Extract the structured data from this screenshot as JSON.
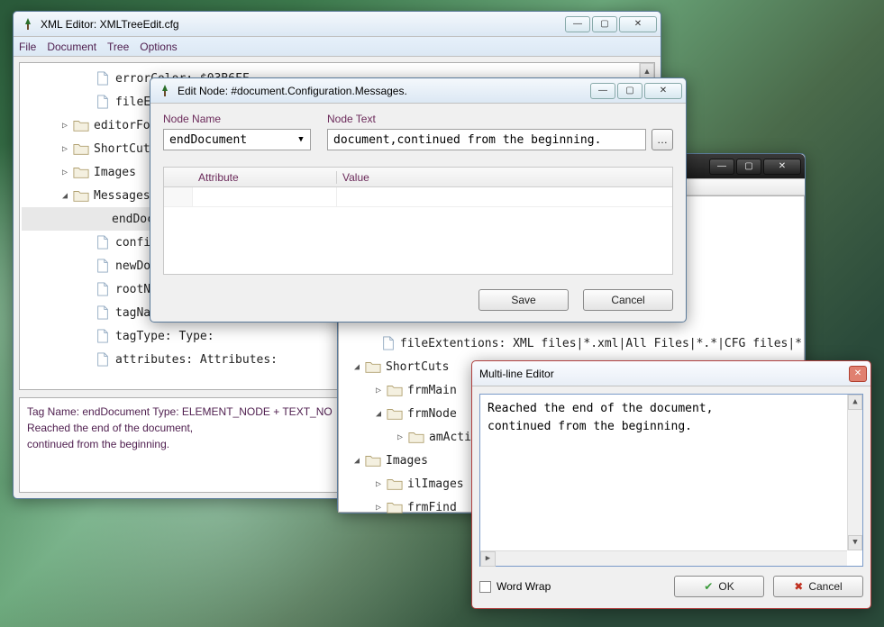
{
  "main": {
    "title": "XML Editor: XMLTreeEdit.cfg",
    "menu": [
      "File",
      "Document",
      "Tree",
      "Options"
    ],
    "tree": [
      {
        "depth": 2,
        "icon": "file",
        "exp": "",
        "text": "errorColor: $03B6FF"
      },
      {
        "depth": 2,
        "icon": "file",
        "exp": "",
        "text": "fileExte"
      },
      {
        "depth": 1,
        "icon": "folder",
        "exp": "▷",
        "text": "editorFont"
      },
      {
        "depth": 1,
        "icon": "folder",
        "exp": "▷",
        "text": "ShortCuts"
      },
      {
        "depth": 1,
        "icon": "folder",
        "exp": "▷",
        "text": "Images"
      },
      {
        "depth": 1,
        "icon": "folder",
        "exp": "◢",
        "text": "Messages"
      },
      {
        "depth": 2,
        "icon": "none",
        "exp": "",
        "text": "endDocum",
        "selected": true
      },
      {
        "depth": 2,
        "icon": "file",
        "exp": "",
        "text": "confirmD"
      },
      {
        "depth": 2,
        "icon": "file",
        "exp": "",
        "text": "newDocum"
      },
      {
        "depth": 2,
        "icon": "file",
        "exp": "",
        "text": "rootNode"
      },
      {
        "depth": 2,
        "icon": "file",
        "exp": "",
        "text": "tagName:"
      },
      {
        "depth": 2,
        "icon": "file",
        "exp": "",
        "text": "tagType: Type:"
      },
      {
        "depth": 2,
        "icon": "file",
        "exp": "",
        "text": "attributes: Attributes:"
      }
    ],
    "status": {
      "l1": "Tag Name: endDocument  Type: ELEMENT_NODE + TEXT_NO",
      "l2": "Reached the end of the document,",
      "l3": "continued from the beginning."
    }
  },
  "edit": {
    "title": "Edit Node: #document.Configuration.Messages.",
    "nodeNameLbl": "Node Name",
    "nodeTextLbl": "Node Text",
    "nodeName": "endDocument",
    "nodeText": "document,continued from the beginning.",
    "attrHdr": "Attribute",
    "valHdr": "Value",
    "save": "Save",
    "cancel": "Cancel"
  },
  "second": {
    "tree": [
      {
        "depth": 1,
        "icon": "file",
        "exp": "",
        "text": "fileExtentions: XML files|*.xml|All Files|*.*|CFG files|*"
      },
      {
        "depth": 0,
        "icon": "folder",
        "exp": "◢",
        "text": "ShortCuts"
      },
      {
        "depth": 1,
        "icon": "folder",
        "exp": "▷",
        "text": "frmMain"
      },
      {
        "depth": 1,
        "icon": "folder",
        "exp": "◢",
        "text": "frmNode"
      },
      {
        "depth": 2,
        "icon": "folder",
        "exp": "▷",
        "text": "amActions"
      },
      {
        "depth": 0,
        "icon": "folder",
        "exp": "◢",
        "text": "Images"
      },
      {
        "depth": 1,
        "icon": "folder",
        "exp": "▷",
        "text": "ilImages"
      },
      {
        "depth": 1,
        "icon": "folder",
        "exp": "▷",
        "text": "frmFind"
      }
    ]
  },
  "mle": {
    "title": "Multi-line Editor",
    "text1": "Reached the end of the document,",
    "text2": "continued from the beginning.",
    "wordwrap": "Word Wrap",
    "ok": "OK",
    "cancel": "Cancel"
  }
}
